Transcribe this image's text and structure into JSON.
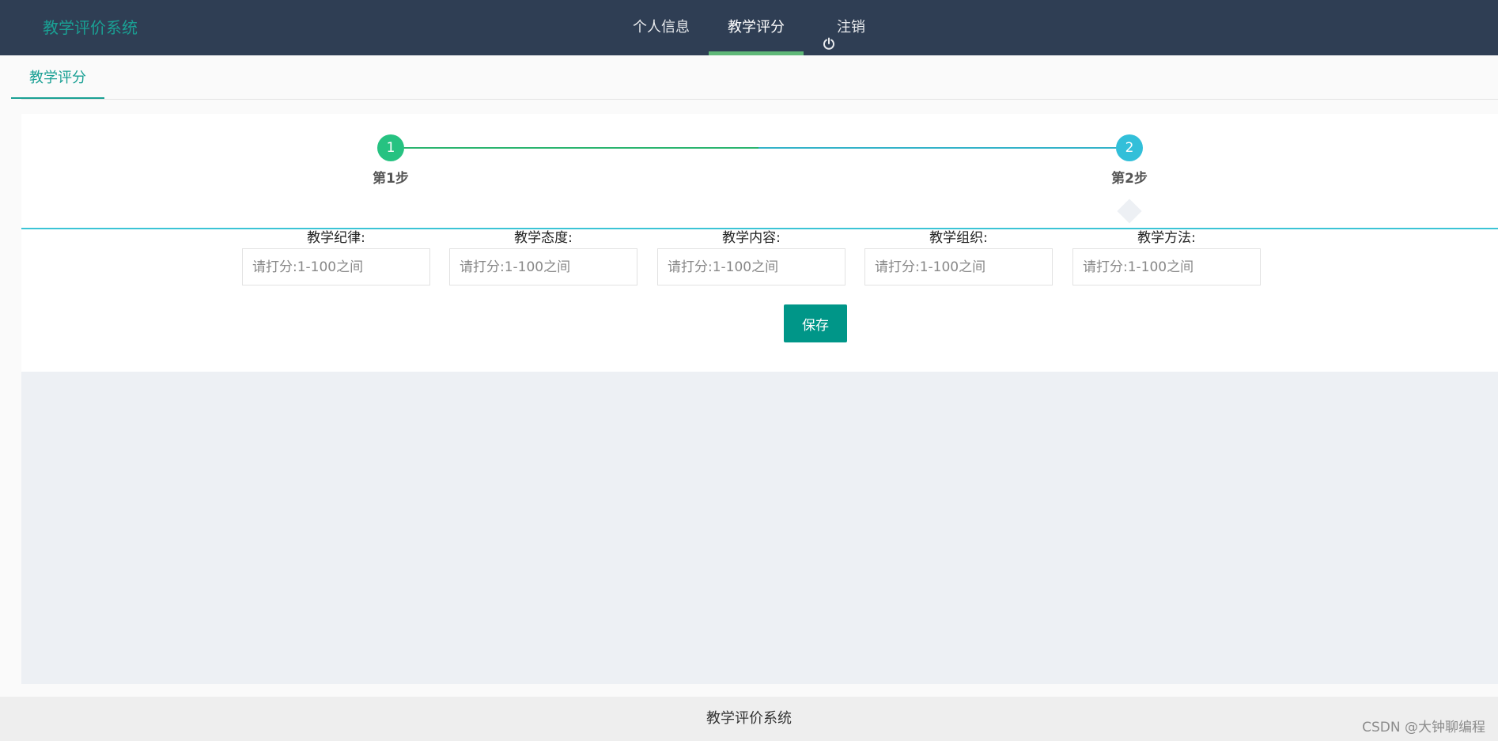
{
  "header": {
    "brand": "教学评价系统",
    "nav": [
      {
        "label": "个人信息",
        "icon": null
      },
      {
        "label": "教学评分",
        "icon": null
      },
      {
        "label": "注销",
        "icon": "power-icon"
      }
    ]
  },
  "tabbar": {
    "active_tab": "教学评分"
  },
  "steps": {
    "step1": {
      "number": "1",
      "label": "第1步"
    },
    "step2": {
      "number": "2",
      "label": "第2步"
    }
  },
  "form": {
    "fields": [
      {
        "label": "教学纪律:",
        "placeholder": "请打分:1-100之间"
      },
      {
        "label": "教学态度:",
        "placeholder": "请打分:1-100之间"
      },
      {
        "label": "教学内容:",
        "placeholder": "请打分:1-100之间"
      },
      {
        "label": "教学组织:",
        "placeholder": "请打分:1-100之间"
      },
      {
        "label": "教学方法:",
        "placeholder": "请打分:1-100之间"
      }
    ],
    "save_label": "保存"
  },
  "footer": {
    "text": "教学评价系统"
  },
  "watermark": "CSDN @大钟聊编程",
  "colors": {
    "header_bg": "#2f3e54",
    "accent": "#009688",
    "step1": "#26c281",
    "step2": "#32bfd9"
  }
}
